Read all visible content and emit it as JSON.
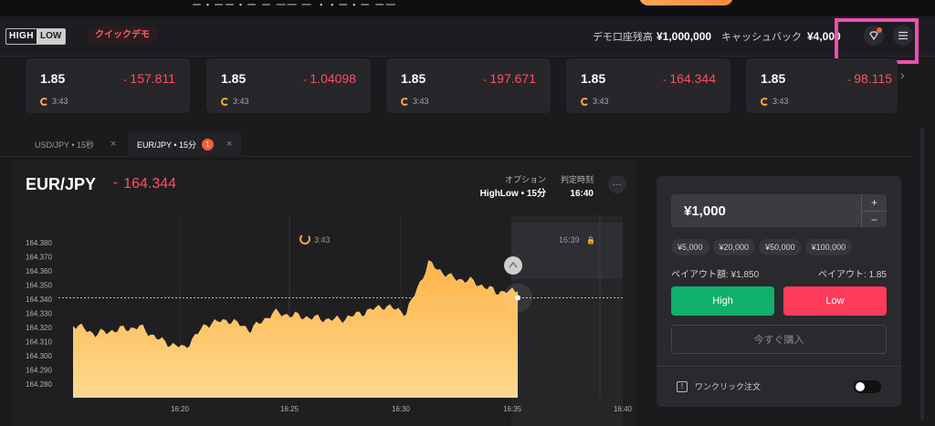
{
  "top_banner": {
    "text": "ー・ーー・ー ー 一一 一 ・・ー・ー ー一"
  },
  "header": {
    "logo_high": "HIGH",
    "logo_low": "LOW",
    "quick_demo": "クイックデモ",
    "demo_balance_label": "デモ口座残高",
    "demo_balance_value": "¥1,000,000",
    "cashback_label": "キャッシュバック",
    "cashback_value": "¥4,000",
    "icons": [
      "gift-icon",
      "menu-icon"
    ],
    "highlight_color": "#f04eb0"
  },
  "tickers": [
    {
      "payout": "1.85",
      "rate": "157.811",
      "timer": "3:43"
    },
    {
      "payout": "1.85",
      "rate": "1.04098",
      "timer": "3:43"
    },
    {
      "payout": "1.85",
      "rate": "197.671",
      "timer": "3:43"
    },
    {
      "payout": "1.85",
      "rate": "164.344",
      "timer": "3:43"
    },
    {
      "payout": "1.85",
      "rate": "98.115",
      "timer": "3:43"
    }
  ],
  "tabs": [
    {
      "label": "USD/JPY • 15秒",
      "active": false
    },
    {
      "label": "EUR/JPY • 15分",
      "active": true,
      "badge": "1"
    }
  ],
  "chart_header": {
    "pair": "EUR/JPY",
    "rate": "164.344",
    "option_label": "オプション",
    "option_value": "HighLow • 15分",
    "expiry_label": "判定時刻",
    "expiry_value": "16:40",
    "more": "···"
  },
  "chart_overlay": {
    "timer_label": "3:43",
    "closed_label": "16:39"
  },
  "chart_data": {
    "type": "area",
    "ylabels": [
      "164.380",
      "164.370",
      "164.360",
      "164.350",
      "164.340",
      "164.330",
      "164.320",
      "164.310",
      "164.300",
      "164.290",
      "164.280"
    ],
    "xlabels": [
      "16:20",
      "16:25",
      "16:30",
      "16:35",
      "16:40"
    ],
    "current_value": 164.341,
    "x_minutes": [
      0,
      1,
      2,
      3,
      4,
      5,
      6,
      7,
      8,
      9,
      10,
      11,
      12,
      13,
      14,
      15,
      16,
      17,
      18,
      19,
      20
    ],
    "values": [
      164.322,
      164.315,
      164.318,
      164.32,
      164.31,
      164.305,
      164.322,
      164.325,
      164.318,
      164.33,
      164.328,
      164.326,
      164.325,
      164.33,
      164.335,
      164.33,
      164.365,
      164.355,
      164.352,
      164.345,
      164.345
    ],
    "fill_color_top": "#ffb347",
    "fill_color_bottom": "#ffd68a"
  },
  "trade": {
    "amount": "¥1,000",
    "plus": "+",
    "minus": "−",
    "presets": [
      "¥5,000",
      "¥20,000",
      "¥50,000",
      "¥100,000"
    ],
    "payout_amount_label": "ペイアウト額: ¥1,850",
    "payout_rate_label": "ペイアウト: 1.85",
    "high": "High",
    "low": "Low",
    "buy_now": "今すぐ購入",
    "one_click": "ワンクリック注文",
    "high_color": "#10b06a",
    "low_color": "#ff3b5c"
  }
}
